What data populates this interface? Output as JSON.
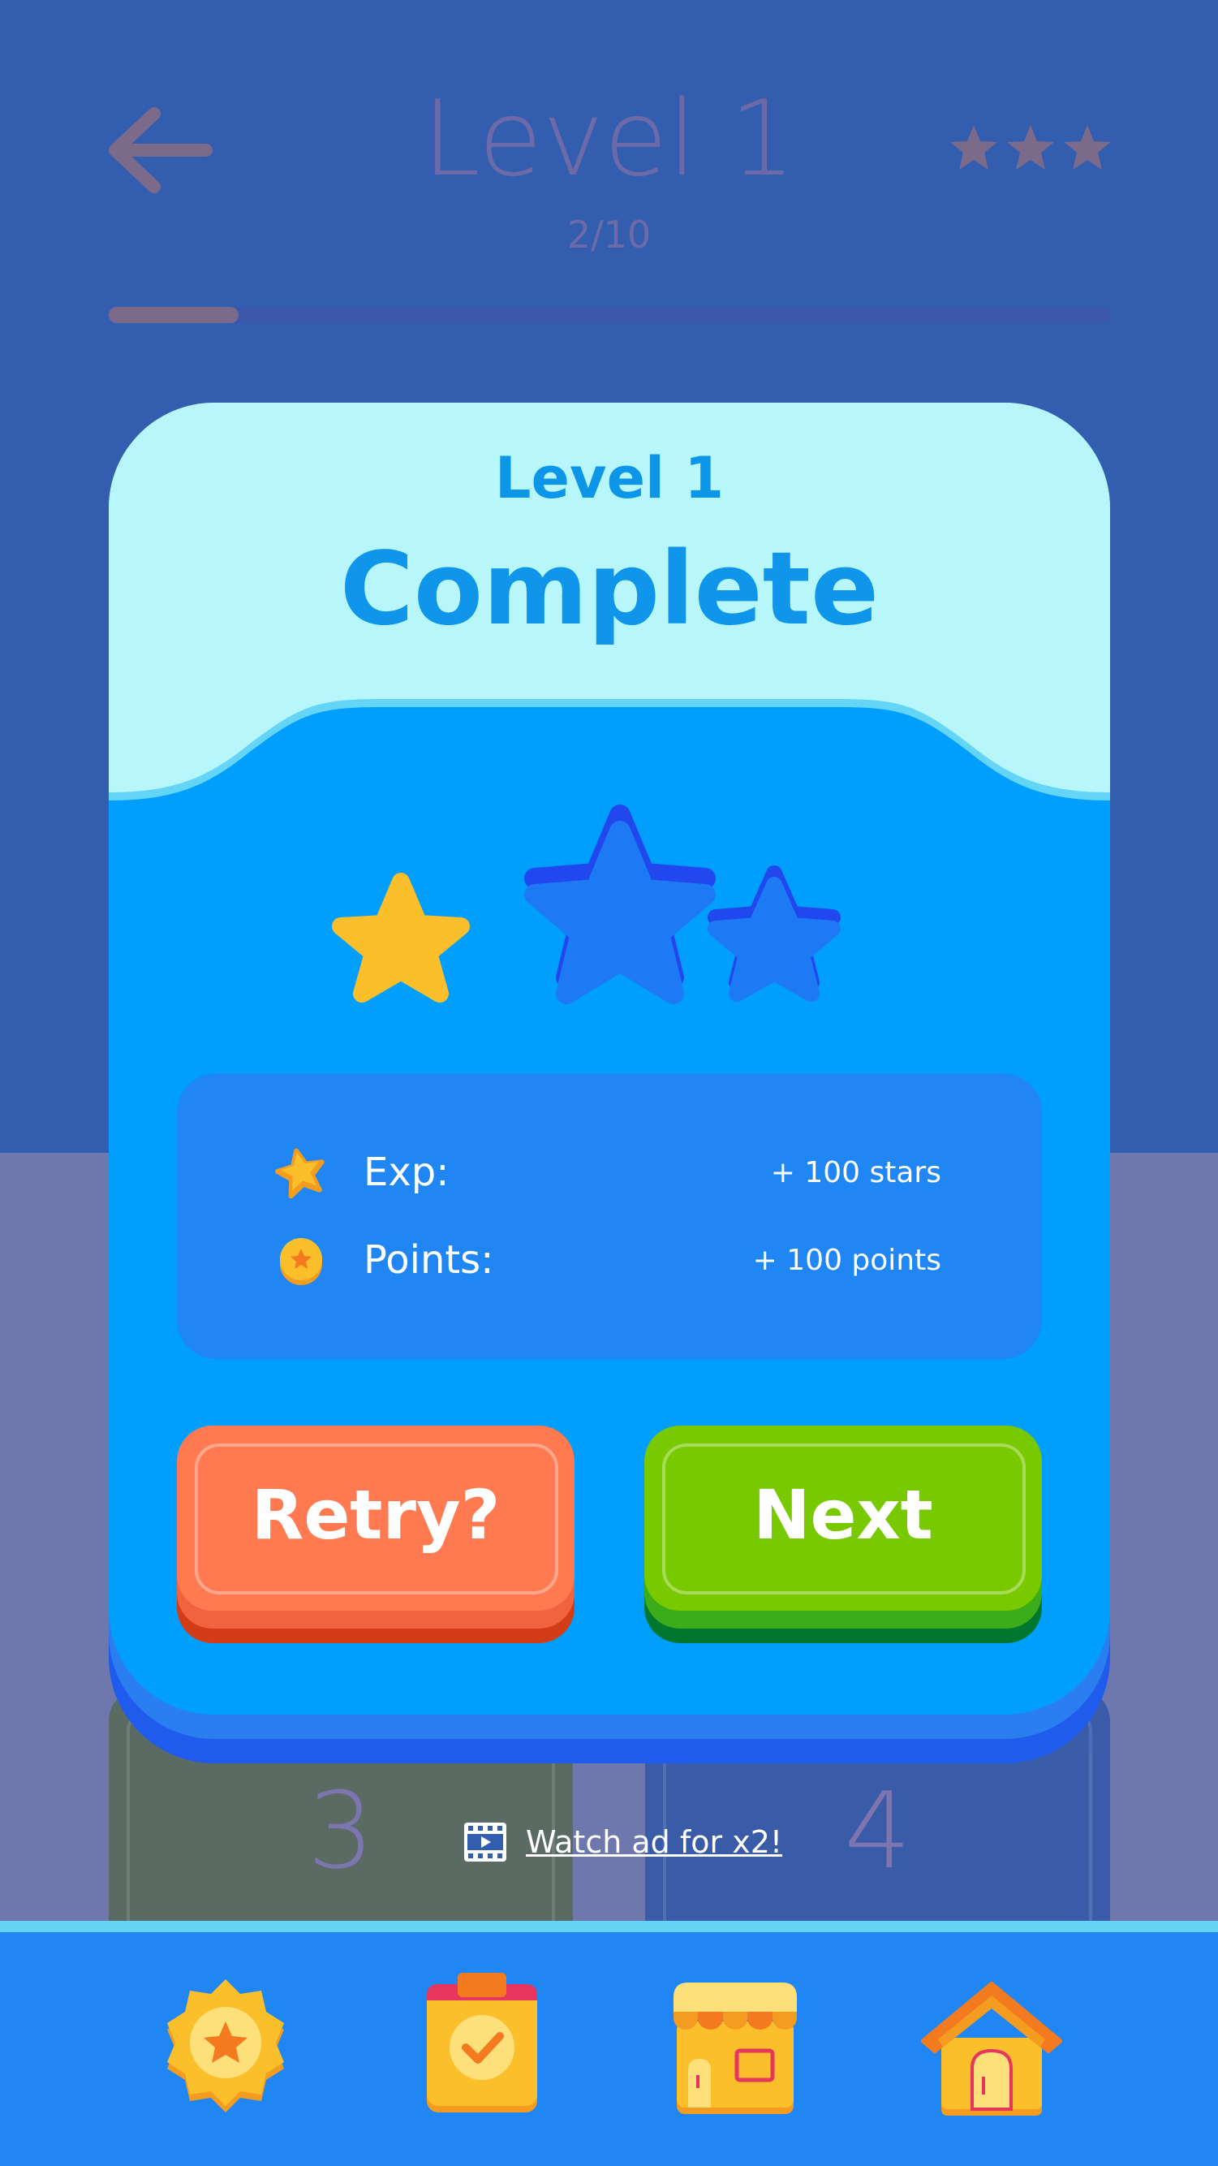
{
  "header": {
    "title": "Level 1",
    "subtitle": "2/10",
    "progress_fraction": 0.13,
    "stars_earned": 0,
    "stars_total": 3
  },
  "modal": {
    "level_label": "Level 1",
    "heading": "Complete",
    "stars": {
      "earned": 1,
      "total": 3
    },
    "rewards": [
      {
        "label": "Exp:",
        "value": "+ 100 stars",
        "icon": "star-icon"
      },
      {
        "label": "Points:",
        "value": "+ 100 points",
        "icon": "coin-icon"
      }
    ],
    "retry_label": "Retry?",
    "next_label": "Next"
  },
  "background_tiles": [
    "3",
    "4"
  ],
  "ad": {
    "label": "Watch ad for x2!",
    "icon": "film-icon"
  },
  "nav": [
    {
      "name": "achievements",
      "icon": "badge-star-icon"
    },
    {
      "name": "tasks",
      "icon": "clipboard-check-icon"
    },
    {
      "name": "shop",
      "icon": "shop-icon"
    },
    {
      "name": "home",
      "icon": "home-icon"
    }
  ],
  "colors": {
    "accent": "#009ffd",
    "star_gold": "#fbbf2c",
    "retry": "#ff7a50",
    "next": "#78c900"
  }
}
